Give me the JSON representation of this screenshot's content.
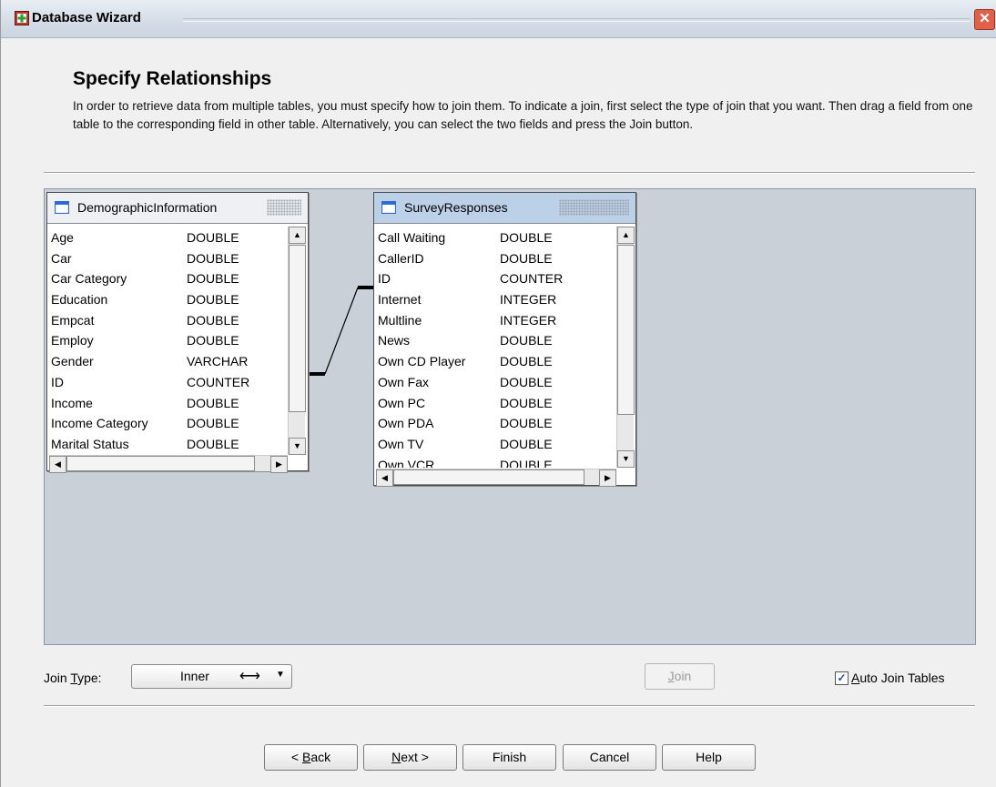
{
  "window": {
    "title": "Database Wizard",
    "close_glyph": "✕"
  },
  "page": {
    "heading": "Specify Relationships",
    "description": "In order to retrieve data from multiple tables, you must specify how to join them. To indicate a join, first select the type of join that you want. Then drag a field from one table to the corresponding field in other table. Alternatively, you can select the two fields and press the Join button."
  },
  "tables": [
    {
      "name": "DemographicInformation",
      "selected": false,
      "fields": [
        {
          "name": "Age",
          "type": "DOUBLE"
        },
        {
          "name": "Car",
          "type": "DOUBLE"
        },
        {
          "name": "Car Category",
          "type": "DOUBLE"
        },
        {
          "name": "Education",
          "type": "DOUBLE"
        },
        {
          "name": "Empcat",
          "type": "DOUBLE"
        },
        {
          "name": "Employ",
          "type": "DOUBLE"
        },
        {
          "name": "Gender",
          "type": "VARCHAR"
        },
        {
          "name": "ID",
          "type": "COUNTER"
        },
        {
          "name": "Income",
          "type": "DOUBLE"
        },
        {
          "name": "Income Category",
          "type": "DOUBLE"
        },
        {
          "name": "Marital Status",
          "type": "DOUBLE"
        }
      ]
    },
    {
      "name": "SurveyResponses",
      "selected": true,
      "fields": [
        {
          "name": "Call Waiting",
          "type": "DOUBLE"
        },
        {
          "name": "CallerID",
          "type": "DOUBLE"
        },
        {
          "name": "ID",
          "type": "COUNTER"
        },
        {
          "name": "Internet",
          "type": "INTEGER"
        },
        {
          "name": "Multline",
          "type": "INTEGER"
        },
        {
          "name": "News",
          "type": "DOUBLE"
        },
        {
          "name": "Own CD Player",
          "type": "DOUBLE"
        },
        {
          "name": "Own Fax",
          "type": "DOUBLE"
        },
        {
          "name": "Own PC",
          "type": "DOUBLE"
        },
        {
          "name": "Own PDA",
          "type": "DOUBLE"
        },
        {
          "name": "Own TV",
          "type": "DOUBLE"
        },
        {
          "name": "Own VCR",
          "type": "DOUBLE"
        }
      ]
    }
  ],
  "join": {
    "label_prefix": "Join ",
    "label_mnemonic": "T",
    "label_suffix": "ype:",
    "type_value": "Inner",
    "type_arrow": "⟷",
    "join_button_mnemonic": "J",
    "join_button_rest": "oin",
    "auto_join_label_mnemonic": "A",
    "auto_join_label_rest": "uto Join Tables",
    "auto_join_checked": true
  },
  "buttons": {
    "back_prefix": "< ",
    "back_mnemonic": "B",
    "back_rest": "ack",
    "next_mnemonic": "N",
    "next_rest": "ext >",
    "finish": "Finish",
    "cancel": "Cancel",
    "help": "Help"
  },
  "colors": {
    "canvas": "#c9d0d8",
    "selected_header": "#bcd0e8",
    "join_line": "#000000"
  }
}
